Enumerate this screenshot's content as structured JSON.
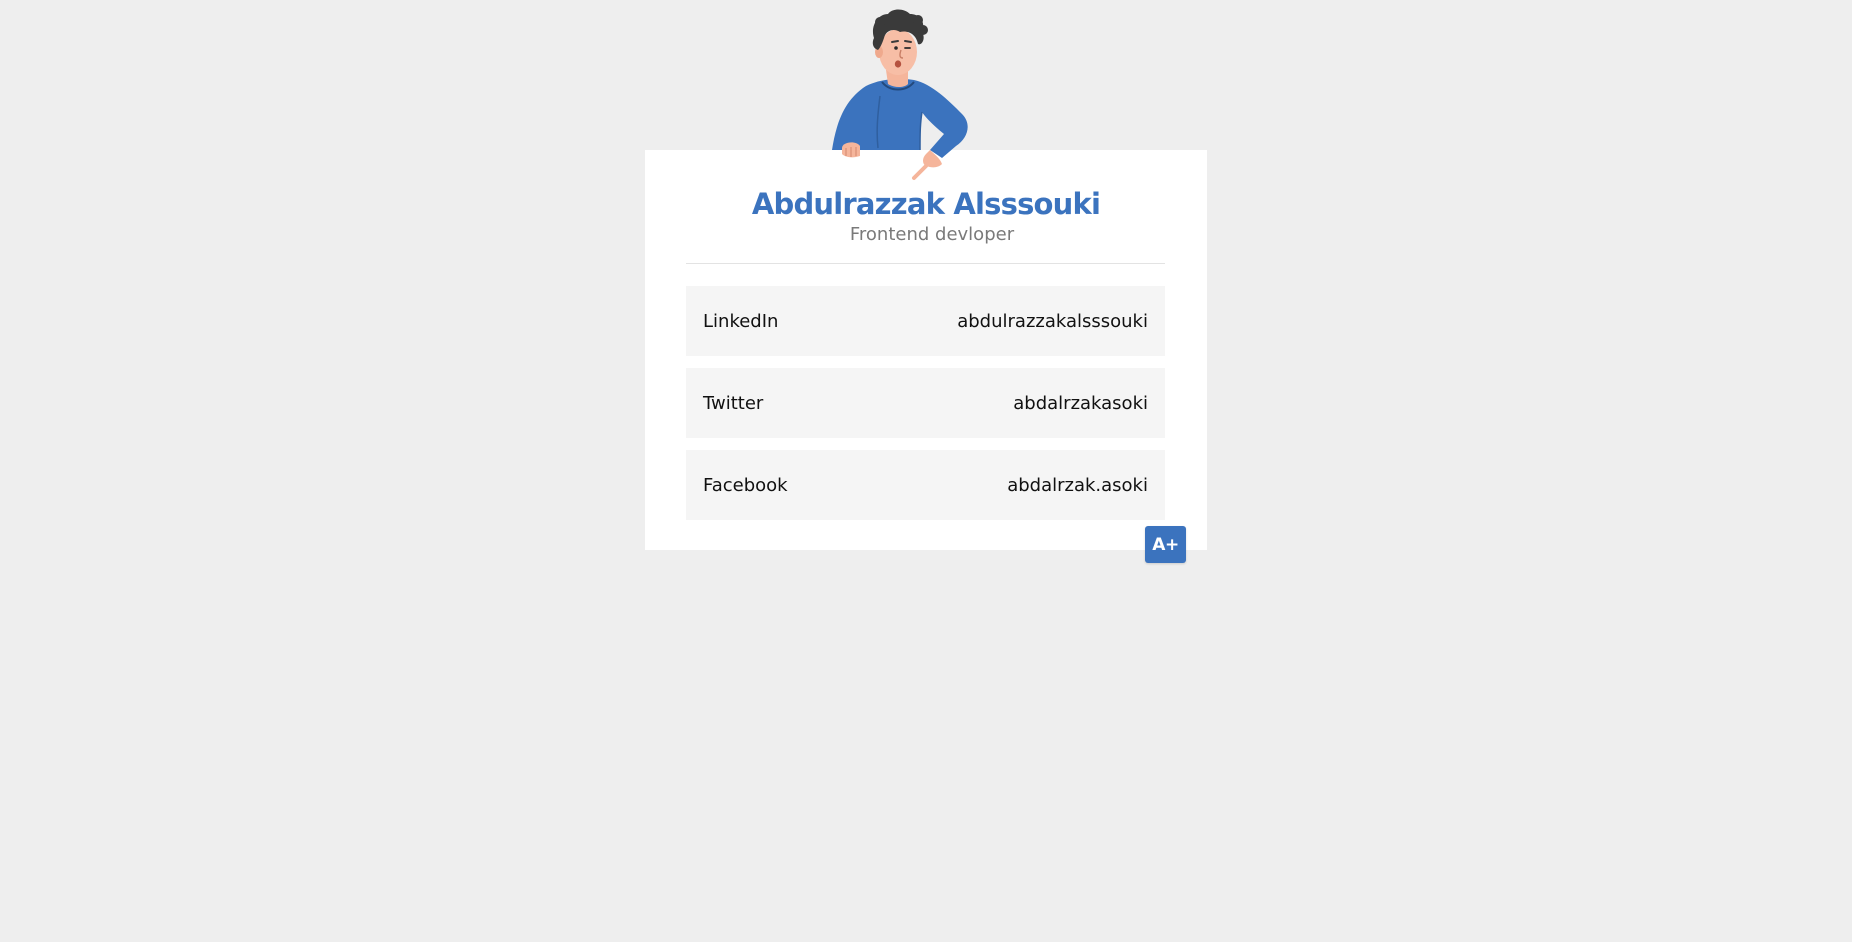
{
  "profile": {
    "name": "Abdulrazzak Alsssouki",
    "role": "Frontend devloper"
  },
  "links": [
    {
      "platform": "LinkedIn",
      "handle": "abdulrazzakalsssouki"
    },
    {
      "platform": "Twitter",
      "handle": "abdalrzakasoki"
    },
    {
      "platform": "Facebook",
      "handle": "abdalrzak.asoki"
    }
  ],
  "controls": {
    "font_size_label": "A+"
  },
  "colors": {
    "accent": "#3b73be",
    "background": "#eeeeee",
    "card": "#ffffff",
    "row": "#f5f5f5",
    "muted_text": "#7a7a7a"
  },
  "icons": {
    "avatar": "person-illustration"
  }
}
